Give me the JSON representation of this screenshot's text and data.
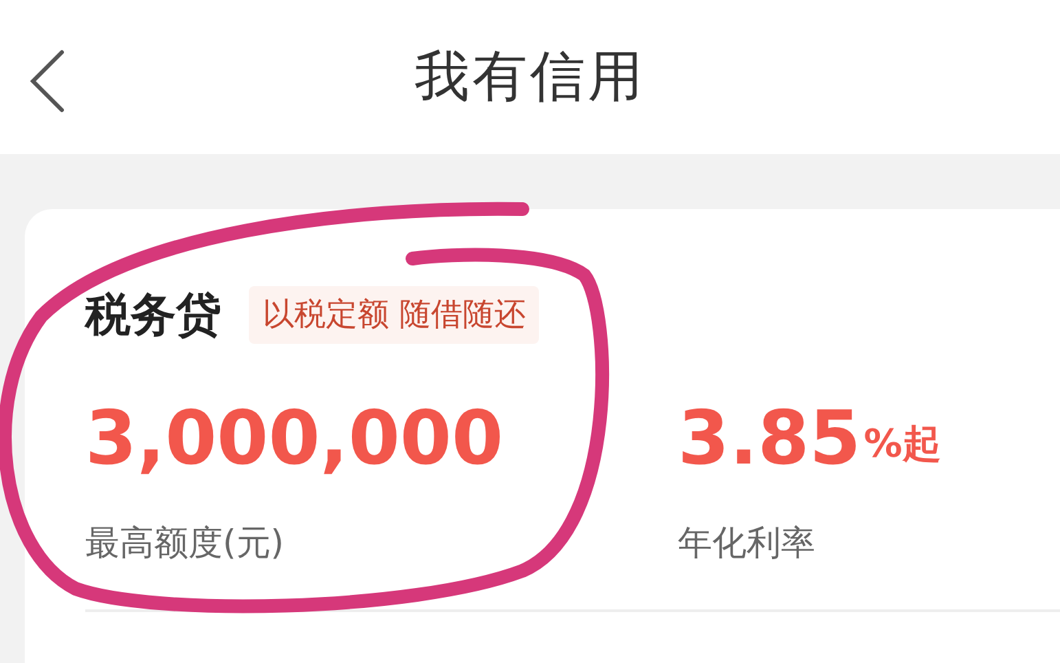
{
  "header": {
    "title": "我有信用"
  },
  "product": {
    "name": "税务贷",
    "tag": "以税定额 随借随还",
    "stats": [
      {
        "value": "3,000,000",
        "label": "最高额度(元)"
      },
      {
        "value": "3.85",
        "suffix": "%起",
        "label": "年化利率"
      }
    ]
  }
}
